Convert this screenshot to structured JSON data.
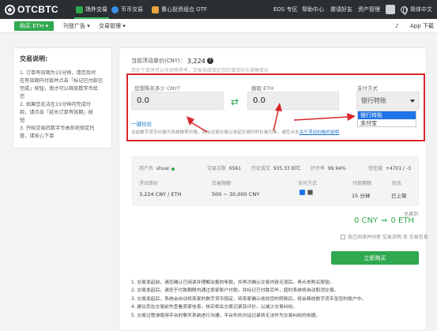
{
  "header": {
    "logo": "OTCBTC",
    "nav": [
      "场外交易",
      "币币交易",
      "曹心投资组合 OTF"
    ],
    "right": [
      "EOS 专区",
      "帮助中心",
      "邀请好友",
      "资产管理"
    ],
    "language": "简体中文",
    "accent_color": "#3fbf5f"
  },
  "subnav": {
    "buy_button": "购买 ETH ▾",
    "links": [
      "刊登广告 ▾",
      "交易管理 ▾"
    ],
    "right": [
      "♪",
      "App 下载"
    ]
  },
  "instructions": {
    "title": "交易说明:",
    "items": [
      "1. 订单有效期为15分钟，请您及时",
      "在有效期内付款并点击「标记已付款已",
      "完成」按钮，我才可以释放数字币给",
      "您",
      "2. 如果您无法在15分钟内完成付",
      "款，请点击「延长订单有效期」按",
      "钮",
      "3. 开始交易后数字币由系统锁定托",
      "管，请安心下单"
    ]
  },
  "order_form": {
    "price_label": "当前浮动单价(CNY)：",
    "price_value": "3,224",
    "note": "您在下单时可以市场等参考，交易系统锁定您的请求中大规模单价",
    "amount_label": "您想购买多少 CNY？",
    "amount_value": "0.0",
    "receive_label": "换取 ETH",
    "receive_value": "0.0",
    "payment_label": "支付方式",
    "payment_selected": "银行转账",
    "payment_options": [
      "银行转账",
      "支付宝"
    ],
    "swap_symbol": "⇄",
    "trade_link": "一键拉出",
    "tip_prefix": "当前数字货币价格为系统推荐价格，实际交易价格以发起交易时的价格为准，请您点击",
    "tip_link": "关于浮动价格的说明"
  },
  "seller": {
    "user_label": "用户名",
    "user_value": "shuai",
    "trades_label": "交易次数",
    "trades_value": "6561",
    "volume_label": "历史成交",
    "volume_value": "935.33 BTC",
    "rate_label": "好评率",
    "rate_value": "99.94%",
    "trust_label": "信任度",
    "trust_value": "+4701 / -3",
    "headers": [
      "浮动单价",
      "交易限额",
      "支付方式",
      "付款期限",
      "状态"
    ],
    "row": [
      "3,224 CNY / ETH",
      "500 ~ 30,000 CNY",
      "15 分钟",
      "已上架"
    ]
  },
  "exchange": {
    "label": "兑换到",
    "from": "0 CNY",
    "arrow": "⇒",
    "to": "0 ETH",
    "read_terms": "我已阅读并同意 交易说明 及 交易信息",
    "buy_button": "立即购买"
  },
  "terms": [
    "1. 交易发起前，请您确认已阅读并理解出售的条款，并再次确认交易内容无误后，再点击购买按钮。",
    "2. 交易发起后，请您于付款期限内通过卖家账户付款，并标记已付款完毕，超时系统将自动取消交易。",
    "3. 交易发起后，系统会自动将卖家的数字货币锁定，待卖家确认收到您的转账后，将会释放数字货币至您的账户中。",
    "4. 建议您在交易前先查看卖家信息，核实相关交易记录及评价，以减少交易纠纷。",
    "5. 交易过程请使用平台的聊天系统进行沟通，平台外的对话记录将无法作为交易纠纷的依据。"
  ]
}
